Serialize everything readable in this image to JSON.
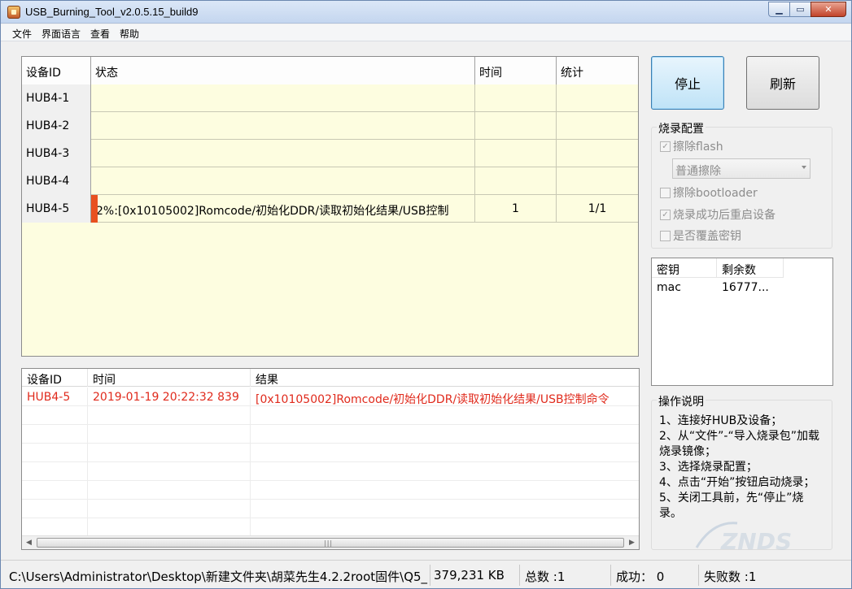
{
  "window": {
    "title": "USB_Burning_Tool_v2.0.5.15_build9",
    "minimize_glyph": "▁",
    "maximize_glyph": "▭",
    "close_glyph": "✕"
  },
  "menu": {
    "items": [
      "文件",
      "界面语言",
      "查看",
      "帮助"
    ]
  },
  "device_table": {
    "headers": [
      "设备ID",
      "状态",
      "时间",
      "统计"
    ],
    "rows": [
      {
        "id": "HUB4-1",
        "status": "",
        "time": "",
        "stat": ""
      },
      {
        "id": "HUB4-2",
        "status": "",
        "time": "",
        "stat": ""
      },
      {
        "id": "HUB4-3",
        "status": "",
        "time": "",
        "stat": ""
      },
      {
        "id": "HUB4-4",
        "status": "",
        "time": "",
        "stat": ""
      },
      {
        "id": "HUB4-5",
        "status": "2%:[0x10105002]Romcode/初始化DDR/读取初始化结果/USB控制",
        "time": "1",
        "stat": "1/1",
        "progress": 0.02
      }
    ]
  },
  "log_table": {
    "headers": [
      "设备ID",
      "时间",
      "结果"
    ],
    "rows": [
      {
        "id": "HUB4-5",
        "time": "2019-01-19 20:22:32 839",
        "result": "[0x10105002]Romcode/初始化DDR/读取初始化结果/USB控制命令"
      }
    ],
    "scroll_grip": "|||"
  },
  "buttons": {
    "stop": "停止",
    "refresh": "刷新"
  },
  "burn_config": {
    "title": "烧录配置",
    "erase_flash": {
      "label": "擦除flash",
      "checked": true
    },
    "erase_mode": "普通擦除",
    "erase_bootloader": {
      "label": "擦除bootloader",
      "checked": false
    },
    "reboot_after": {
      "label": "烧录成功后重启设备",
      "checked": true
    },
    "overwrite_key": {
      "label": "是否覆盖密钥",
      "checked": false
    }
  },
  "key_table": {
    "headers": [
      "密钥",
      "剩余数"
    ],
    "rows": [
      {
        "key": "mac",
        "remaining": "16777..."
      }
    ]
  },
  "instructions": {
    "title": "操作说明",
    "lines": [
      "1、连接好HUB及设备；",
      "2、从“文件”-“导入烧录包”加载烧录镜像；",
      "3、选择烧录配置；",
      "4、点击“开始”按钮启动烧录；",
      "5、关闭工具前，先“停止”烧录。"
    ]
  },
  "statusbar": {
    "path": "C:\\Users\\Administrator\\Desktop\\新建文件夹\\胡菜先生4.2.2root固件\\Q5_",
    "size": "379,231 KB",
    "total": "总数 :1",
    "success": "成功： 0",
    "fail": "失败数 :1"
  },
  "colors": {
    "table_bg": "#fdfde0",
    "log_error": "#e02a1c",
    "progress": "#e8501f"
  }
}
